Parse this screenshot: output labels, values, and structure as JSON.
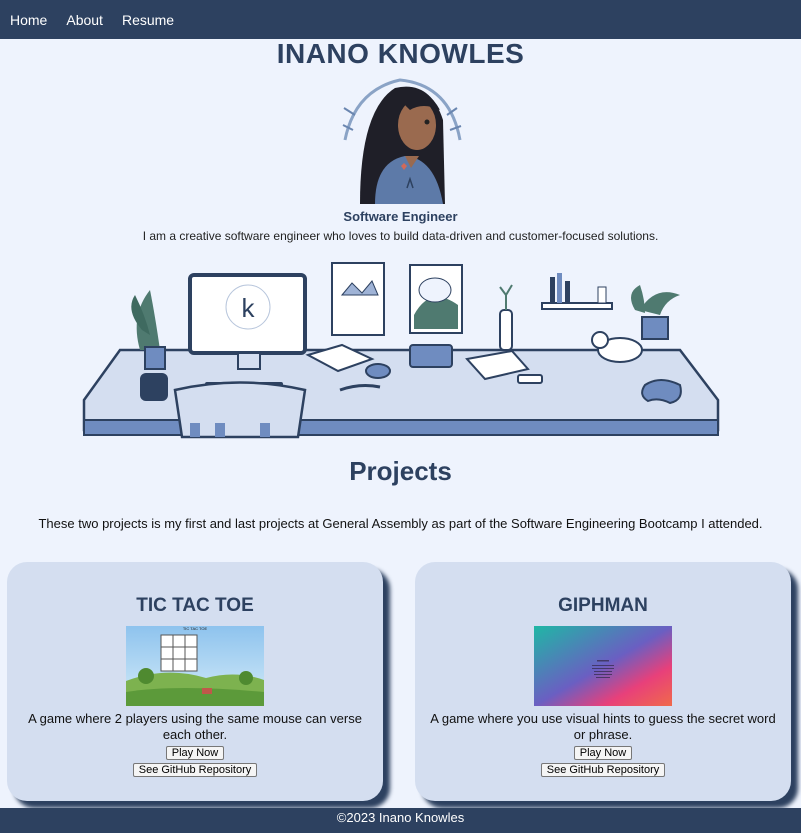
{
  "nav": {
    "items": [
      {
        "label": "Home"
      },
      {
        "label": "About"
      },
      {
        "label": "Resume"
      }
    ]
  },
  "hero": {
    "name": "INANO KNOWLES",
    "job_title": "Software Engineer",
    "tagline": "I am a creative software engineer who loves to build data-driven and customer-focused solutions.",
    "logo_letter": "k"
  },
  "projects": {
    "title": "Projects",
    "intro": "These two projects is my first and last projects at General Assembly as part of the Software Engineering Bootcamp I attended.",
    "cards": [
      {
        "title": "TIC TAC TOE",
        "thumb_title": "TIC TAC TOE",
        "description": "A game where 2 players using the same mouse can verse each other.",
        "play_label": "Play Now",
        "repo_label": "See GitHub Repository"
      },
      {
        "title": "GIPHMAN",
        "description": "A game where you use visual hints to guess the secret word or phrase.",
        "play_label": "Play Now",
        "repo_label": "See GitHub Repository"
      }
    ]
  },
  "footer": {
    "text": "©2023 Inano Knowles"
  },
  "colors": {
    "navy": "#2d4160",
    "page_bg": "#eef3fd",
    "card_bg": "#d4def0"
  }
}
